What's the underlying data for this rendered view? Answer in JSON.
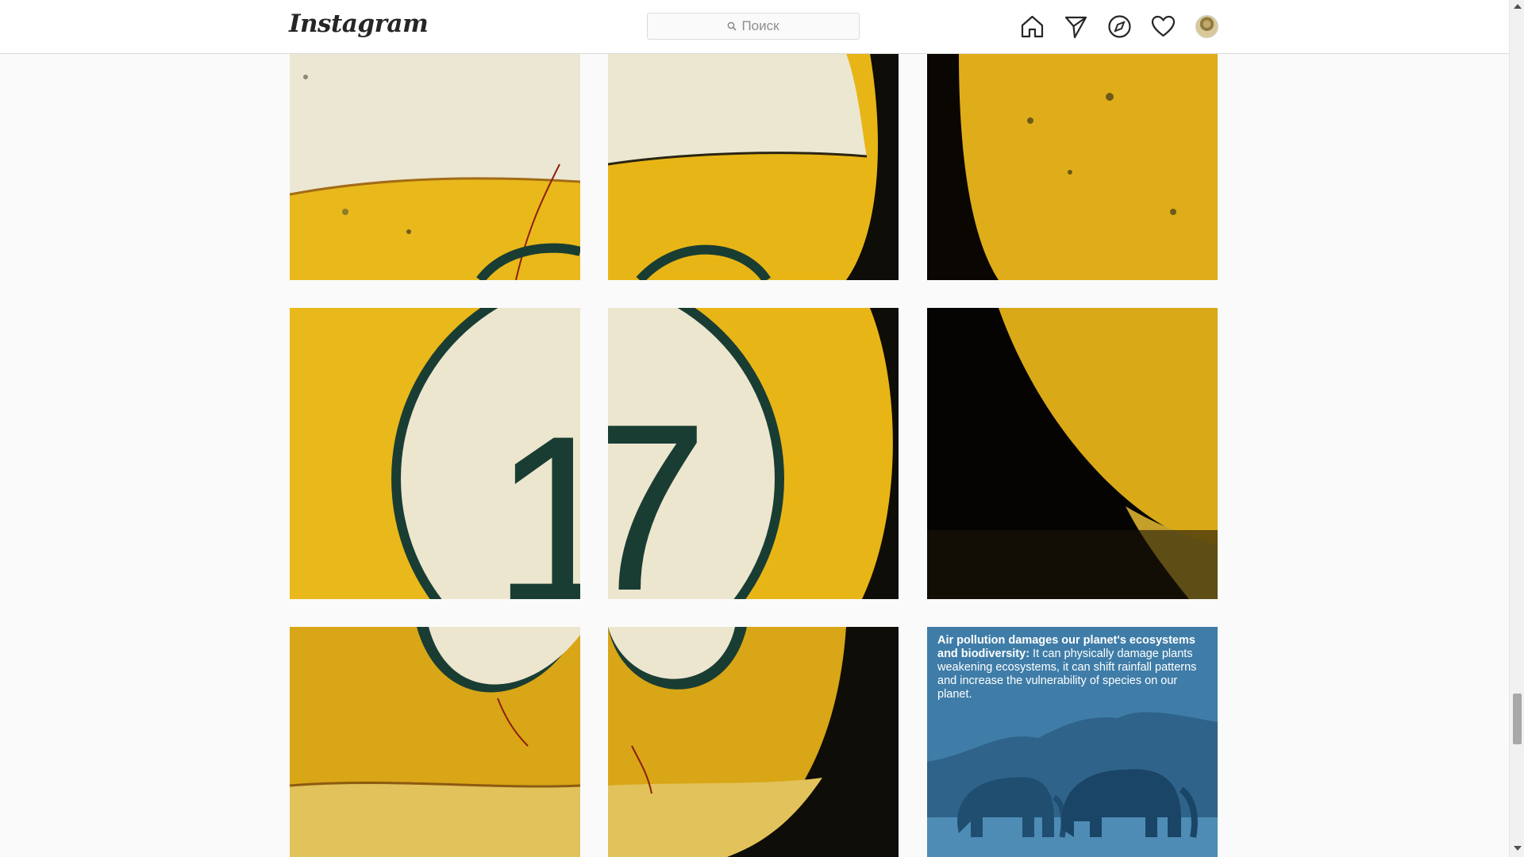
{
  "app": {
    "logo_text": "Instagram"
  },
  "search": {
    "placeholder": "Поиск",
    "icon": "search-icon"
  },
  "nav": {
    "icons": [
      "home-icon",
      "direct-icon",
      "explore-icon",
      "activity-heart-icon",
      "profile-avatar"
    ]
  },
  "post_caption": {
    "bold": "Air pollution damages our planet's ecosystems and biodiversity:",
    "body": " It can physically damage plants weakening ecosystems, it can shift rainfall patterns and increase the vulnerability of species on our planet."
  },
  "grid": {
    "ball_number_left": "1",
    "ball_number_right": "7"
  },
  "colors": {
    "ball_yellow": "#e7b81a",
    "ball_cream": "#ebe6cf",
    "eco_blue": "#3f7da8"
  }
}
